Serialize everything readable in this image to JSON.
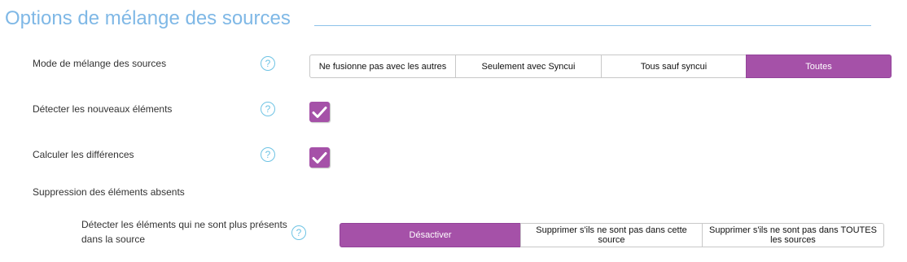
{
  "section": {
    "title": "Options de mélange des sources"
  },
  "rows": {
    "merge_mode": {
      "label": "Mode de mélange des sources",
      "help": "?",
      "options": [
        {
          "label": "Ne fusionne pas avec les autres",
          "selected": false
        },
        {
          "label": "Seulement avec Syncui",
          "selected": false
        },
        {
          "label": "Tous sauf syncui",
          "selected": false
        },
        {
          "label": "Toutes",
          "selected": true
        }
      ]
    },
    "detect_new": {
      "label": "Détecter les nouveaux éléments",
      "help": "?",
      "checked": true
    },
    "compute_diff": {
      "label": "Calculer les différences",
      "help": "?",
      "checked": true
    },
    "deletion": {
      "label": "Suppression des éléments absents"
    },
    "detect_missing": {
      "label_line1": "Détecter les éléments qui ne sont plus présents",
      "label_line2": "dans la source",
      "help": "?",
      "options": [
        {
          "label": "Désactiver",
          "selected": true
        },
        {
          "label": "Supprimer s'ils ne sont pas dans cette source",
          "selected": false
        },
        {
          "label": "Supprimer s'ils ne sont pas dans TOUTES les sources",
          "selected": false
        }
      ]
    }
  },
  "colors": {
    "accent": "#a551a8",
    "title": "#7fb8e6",
    "help": "#6ec3e4"
  }
}
